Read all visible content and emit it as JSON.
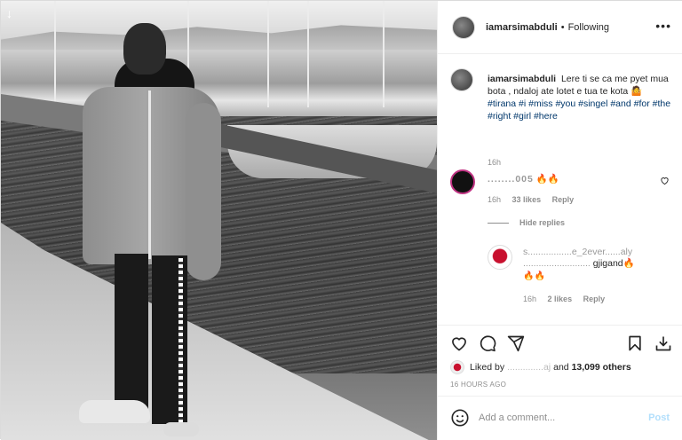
{
  "header": {
    "username": "iamarsimabduli",
    "separator": "•",
    "follow_status": "Following",
    "more_icon": "•••"
  },
  "caption": {
    "username": "iamarsimabduli",
    "text": "Lere ti se ca me pyet mua bota , ndaloj ate lotet e tua te kota 🤷",
    "hashtags": "#tirana #i #miss #you #singel #and #for #the #right #girl #here",
    "time": "16h"
  },
  "comments": [
    {
      "username": "........005",
      "text": "🔥🔥",
      "time": "16h",
      "likes": "33 likes",
      "reply": "Reply"
    }
  ],
  "hide_replies": "Hide replies",
  "reply": {
    "text_obscured": "s.................e_2ever......aly ..........................",
    "text_visible": "gjigand🔥",
    "fire": "🔥🔥",
    "time": "16h",
    "likes": "2 likes",
    "reply": "Reply"
  },
  "likes": {
    "prefix": "Liked by",
    "obscured": "..............aj",
    "suffix": "and",
    "others": "13,099 others"
  },
  "timestamp": "16 HOURS AGO",
  "add_comment": {
    "placeholder": "Add a comment...",
    "post": "Post"
  },
  "icons": {
    "download": "↓",
    "heart": "heart-icon",
    "comment": "comment-icon",
    "share": "share-icon",
    "save": "bookmark-icon",
    "download2": "download-icon"
  },
  "colors": {
    "link": "#00376b",
    "muted": "#8e8e8e",
    "post_disabled": "#b2dffc"
  }
}
